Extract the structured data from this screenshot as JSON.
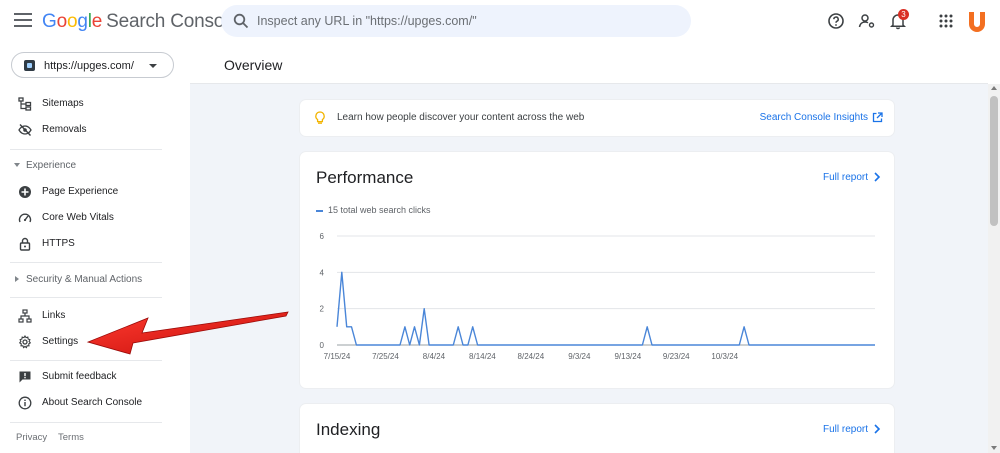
{
  "app": {
    "logo_letters": [
      "G",
      "o",
      "o",
      "g",
      "l",
      "e"
    ],
    "product_name": "Search Console"
  },
  "search": {
    "placeholder": "Inspect any URL in \"https://upges.com/\""
  },
  "header": {
    "notification_count": "3",
    "icons": [
      "help-icon",
      "account-settings-icon",
      "notifications-bell-icon",
      "apps-grid-icon",
      "brand-u-logo"
    ]
  },
  "property": {
    "url": "https://upges.com/"
  },
  "sidebar": {
    "items": [
      {
        "label": "Sitemaps",
        "icon": "sitemap-icon"
      },
      {
        "label": "Removals",
        "icon": "visibility-off-icon"
      },
      {
        "label": "Page Experience",
        "icon": "page-experience-icon"
      },
      {
        "label": "Core Web Vitals",
        "icon": "speed-gauge-icon"
      },
      {
        "label": "HTTPS",
        "icon": "lock-icon"
      },
      {
        "label": "Links",
        "icon": "links-icon"
      },
      {
        "label": "Settings",
        "icon": "settings-gear-icon"
      },
      {
        "label": "Submit feedback",
        "icon": "feedback-icon"
      },
      {
        "label": "About Search Console",
        "icon": "info-icon"
      }
    ],
    "sections": {
      "experience": "Experience",
      "security": "Security & Manual Actions"
    },
    "footer": {
      "privacy": "Privacy",
      "terms": "Terms"
    }
  },
  "main": {
    "title": "Overview",
    "tip": {
      "text": "Learn how people discover your content across the web",
      "link": "Search Console Insights"
    },
    "performance": {
      "title": "Performance",
      "full_report": "Full report",
      "legend": "15 total web search clicks"
    },
    "indexing": {
      "title": "Indexing",
      "full_report": "Full report"
    }
  },
  "colors": {
    "accent_blue": "#1a73e8",
    "line_blue": "#4a86d8",
    "annotation_red": "#e8130f",
    "badge_red": "#d93025",
    "brand_orange": "#f36f21"
  },
  "chart_data": {
    "type": "line",
    "title": "",
    "series": [
      {
        "name": "15 total web search clicks",
        "x_start": "7/15/24",
        "values": [
          1,
          4,
          1,
          1,
          0,
          0,
          0,
          0,
          0,
          0,
          0,
          0,
          0,
          0,
          1,
          0,
          1,
          0,
          2,
          0,
          0,
          0,
          0,
          0,
          0,
          1,
          0,
          0,
          1,
          0,
          0,
          0,
          0,
          0,
          0,
          0,
          0,
          0,
          0,
          0,
          0,
          0,
          0,
          0,
          0,
          0,
          0,
          0,
          0,
          0,
          0,
          0,
          0,
          0,
          0,
          0,
          0,
          0,
          0,
          0,
          0,
          0,
          0,
          0,
          1,
          0,
          0,
          0,
          0,
          0,
          0,
          0,
          0,
          0,
          0,
          0,
          0,
          0,
          0,
          0,
          0,
          0,
          0,
          0,
          1,
          0,
          0,
          0,
          0,
          0,
          0,
          0,
          0,
          0,
          0,
          0,
          0,
          0,
          0,
          0,
          0,
          0,
          0,
          0,
          0,
          0,
          0,
          0,
          0,
          0,
          0,
          0
        ]
      }
    ],
    "x_tick_labels": [
      "7/15/24",
      "7/25/24",
      "8/4/24",
      "8/14/24",
      "8/24/24",
      "9/3/24",
      "9/13/24",
      "9/23/24",
      "10/3/24"
    ],
    "y_tick_labels": [
      "0",
      "2",
      "4",
      "6"
    ],
    "ylim": [
      0,
      6
    ],
    "grid": true,
    "xlabel": "",
    "ylabel": ""
  }
}
